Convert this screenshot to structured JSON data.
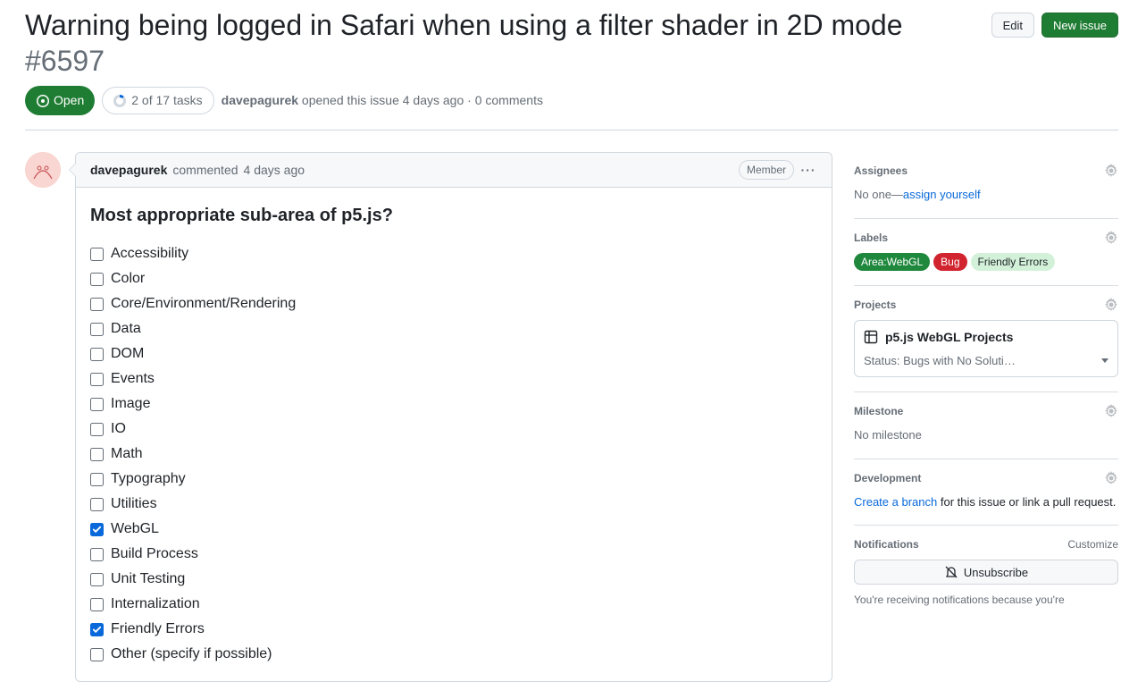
{
  "issue": {
    "title": "Warning being logged in Safari when using a filter shader in 2D mode",
    "number": "#6597",
    "state": "Open",
    "tasks_summary": "2 of 17 tasks",
    "author": "davepagurek",
    "opened_text": "opened this issue 4 days ago",
    "comments_text": "0 comments"
  },
  "actions": {
    "edit": "Edit",
    "new_issue": "New issue"
  },
  "comment": {
    "author": "davepagurek",
    "action": "commented",
    "time": "4 days ago",
    "badge": "Member",
    "heading": "Most appropriate sub-area of p5.js?",
    "tasks": [
      {
        "label": "Accessibility",
        "checked": false
      },
      {
        "label": "Color",
        "checked": false
      },
      {
        "label": "Core/Environment/Rendering",
        "checked": false
      },
      {
        "label": "Data",
        "checked": false
      },
      {
        "label": "DOM",
        "checked": false
      },
      {
        "label": "Events",
        "checked": false
      },
      {
        "label": "Image",
        "checked": false
      },
      {
        "label": "IO",
        "checked": false
      },
      {
        "label": "Math",
        "checked": false
      },
      {
        "label": "Typography",
        "checked": false
      },
      {
        "label": "Utilities",
        "checked": false
      },
      {
        "label": "WebGL",
        "checked": true
      },
      {
        "label": "Build Process",
        "checked": false
      },
      {
        "label": "Unit Testing",
        "checked": false
      },
      {
        "label": "Internalization",
        "checked": false
      },
      {
        "label": "Friendly Errors",
        "checked": true
      },
      {
        "label": "Other (specify if possible)",
        "checked": false
      }
    ]
  },
  "sidebar": {
    "assignees": {
      "title": "Assignees",
      "none": "No one—",
      "link": "assign yourself"
    },
    "labels": {
      "title": "Labels",
      "items": [
        {
          "text": "Area:WebGL",
          "bg": "#1f883d",
          "fg": "#ffffff"
        },
        {
          "text": "Bug",
          "bg": "#d1242f",
          "fg": "#ffffff"
        },
        {
          "text": "Friendly Errors",
          "bg": "#d3f1d8",
          "fg": "#1f2328"
        }
      ]
    },
    "projects": {
      "title": "Projects",
      "name": "p5.js WebGL Projects",
      "status_prefix": "Status:",
      "status_value": "Bugs with No Soluti…"
    },
    "milestone": {
      "title": "Milestone",
      "none": "No milestone"
    },
    "development": {
      "title": "Development",
      "link": "Create a branch",
      "rest": " for this issue or link a pull request."
    },
    "notifications": {
      "title": "Notifications",
      "customize": "Customize",
      "unsubscribe": "Unsubscribe",
      "footer": "You're receiving notifications because you're"
    }
  }
}
